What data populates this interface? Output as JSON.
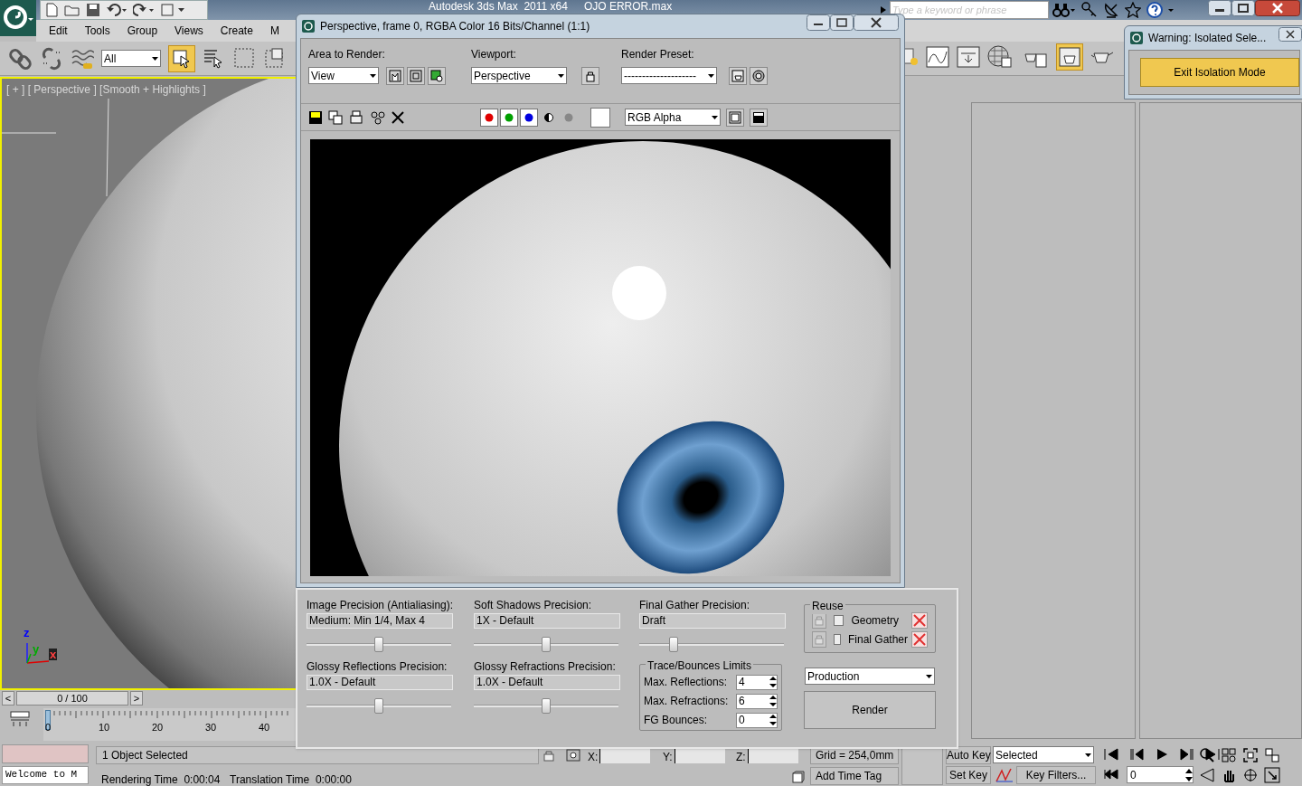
{
  "app_title": "Autodesk 3ds Max  2011 x64",
  "file_name": "OJO ERROR.max",
  "search": {
    "placeholder": "Type a keyword or phrase"
  },
  "menu": [
    "Edit",
    "Tools",
    "Group",
    "Views",
    "Create",
    "M"
  ],
  "selection_filter": "All",
  "viewport_label": "[ + ] [ Perspective ] [Smooth + Highlights ]",
  "axis_labels": [
    "z",
    "y",
    "x"
  ],
  "time_slider": {
    "prev": "<",
    "position": "0 / 100",
    "next": ">"
  },
  "track_ticks": [
    "0",
    "10",
    "20",
    "30",
    "40"
  ],
  "render_window": {
    "title": "Perspective, frame 0, RGBA Color 16 Bits/Channel (1:1)",
    "area_to_render": {
      "label": "Area to Render:",
      "value": "View"
    },
    "viewport": {
      "label": "Viewport:",
      "value": "Perspective"
    },
    "render_preset": {
      "label": "Render Preset:",
      "value": "--------------------"
    },
    "channels": [
      {
        "kind": "red",
        "on": true
      },
      {
        "kind": "green",
        "on": true
      },
      {
        "kind": "blue",
        "on": true
      },
      {
        "kind": "alpha",
        "on": false
      },
      {
        "kind": "mono",
        "on": false
      }
    ],
    "display_channel": "RGB Alpha"
  },
  "render_settings": {
    "precision_rows": [
      [
        {
          "label": "Image Precision (Antialiasing):",
          "value": "Medium: Min 1/4, Max 4",
          "level": 0.5
        },
        {
          "label": "Soft Shadows Precision:",
          "value": "1X - Default",
          "level": 0.5
        },
        {
          "label": "Final Gather Precision:",
          "value": "Draft",
          "level": 0.22
        }
      ],
      [
        {
          "label": "Glossy Reflections Precision:",
          "value": "1.0X - Default",
          "level": 0.5
        },
        {
          "label": "Glossy Refractions Precision:",
          "value": "1.0X - Default",
          "level": 0.5
        }
      ]
    ],
    "trace_limits": {
      "title": "Trace/Bounces Limits",
      "fields": [
        {
          "label": "Max. Reflections:",
          "value": "4"
        },
        {
          "label": "Max. Refractions:",
          "value": "6"
        },
        {
          "label": "FG Bounces:",
          "value": "0"
        }
      ]
    },
    "reuse": {
      "title": "Reuse",
      "items": [
        {
          "label": "Geometry",
          "checked": false
        },
        {
          "label": "Final Gather",
          "checked": false
        }
      ]
    },
    "mode": "Production",
    "render_button": "Render"
  },
  "warning": {
    "title": "Warning: Isolated Sele...",
    "button": "Exit Isolation Mode"
  },
  "status": {
    "selection_count": "1 Object Selected",
    "rendering_time": "Rendering Time  0:00:04",
    "translation_time": "Translation Time  0:00:00",
    "listener": "Welcome to M",
    "coords": [
      "X:",
      "Y:",
      "Z:"
    ],
    "grid": "Grid = 254,0mm",
    "add_time_tag": "Add Time Tag",
    "auto_key": "Auto Key",
    "set_key": "Set Key",
    "key_mode": "Selected",
    "key_filters": "Key Filters...",
    "current_frame": "0"
  }
}
